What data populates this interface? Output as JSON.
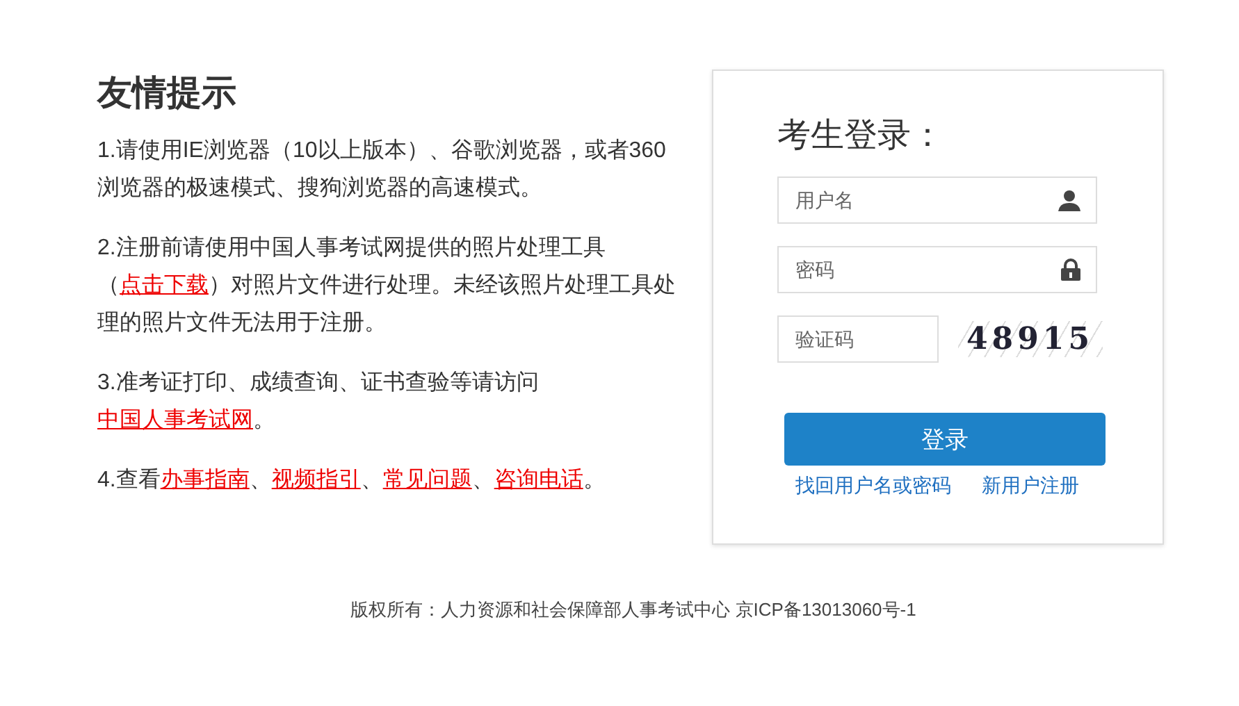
{
  "tips": {
    "title": "友情提示",
    "items": [
      [
        {
          "text": "1.请使用IE浏览器（10以上版本）、谷歌浏览器，或者360浏览器的极速模式、搜狗浏览器的高速模式。",
          "link": false
        }
      ],
      [
        {
          "text": "2.注册前请使用中国人事考试网提供的照片处理工具（",
          "link": false
        },
        {
          "text": "点击下载",
          "link": true
        },
        {
          "text": "）对照片文件进行处理。未经该照片处理工具处理的照片文件无法用于注册。",
          "link": false
        }
      ],
      [
        {
          "text": "3.准考证打印、成绩查询、证书查验等请访问",
          "link": false
        },
        {
          "text": "中国人事考试网",
          "link": true
        },
        {
          "text": "。",
          "link": false
        }
      ],
      [
        {
          "text": "4.查看",
          "link": false
        },
        {
          "text": "办事指南",
          "link": true
        },
        {
          "text": "、",
          "link": false
        },
        {
          "text": "视频指引",
          "link": true
        },
        {
          "text": "、",
          "link": false
        },
        {
          "text": "常见问题",
          "link": true
        },
        {
          "text": "、",
          "link": false
        },
        {
          "text": "咨询电话",
          "link": true
        },
        {
          "text": "。",
          "link": false
        }
      ]
    ]
  },
  "login": {
    "title": "考生登录：",
    "username": {
      "placeholder": "用户名"
    },
    "password": {
      "placeholder": "密码"
    },
    "captcha_field": {
      "placeholder": "验证码"
    },
    "captcha": "48915",
    "submit": "登录",
    "links": [
      "找回用户名或密码",
      "新用户注册"
    ]
  },
  "footer": "版权所有：人力资源和社会保障部人事考试中心 京ICP备13013060号-1"
}
